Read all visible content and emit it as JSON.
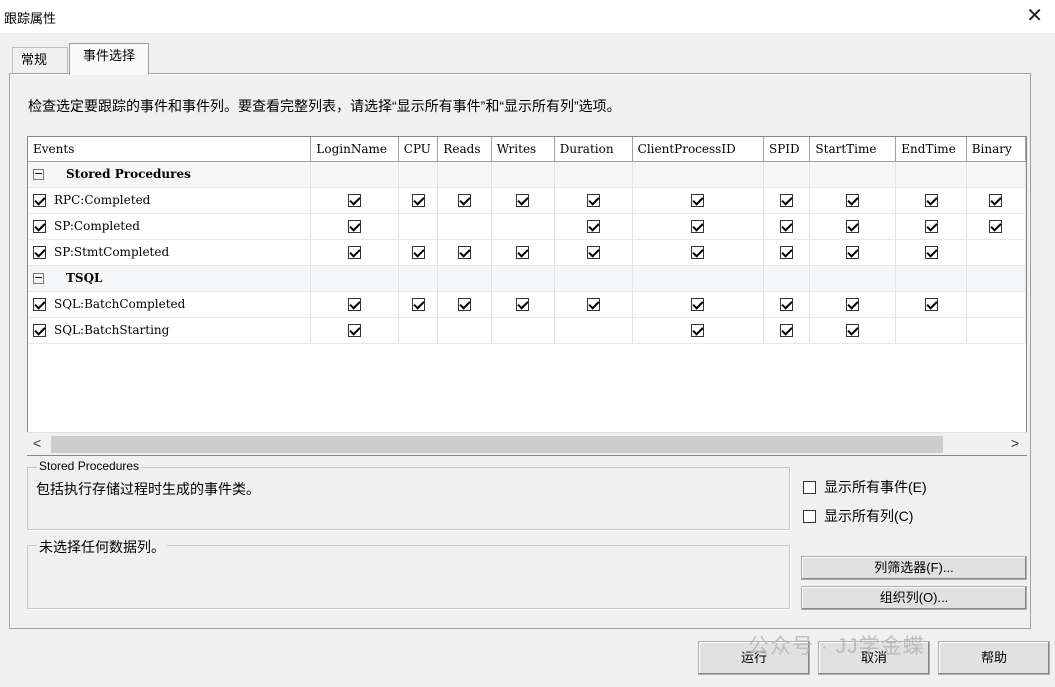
{
  "window": {
    "title": "跟踪属性",
    "close_symbol": "✕"
  },
  "tabs": [
    {
      "label": "常规",
      "active": false
    },
    {
      "label": "事件选择",
      "active": true
    }
  ],
  "instruction": "检查选定要跟踪的事件和事件列。要查看完整列表，请选择“显示所有事件”和“显示所有列”选项。",
  "grid": {
    "columns": [
      "Events",
      "LoginName",
      "CPU",
      "Reads",
      "Writes",
      "Duration",
      "ClientProcessID",
      "SPID",
      "StartTime",
      "EndTime",
      "Binary"
    ],
    "rows": [
      {
        "type": "group",
        "name": "Stored Procedures",
        "expander": "−"
      },
      {
        "type": "event",
        "name": "RPC:Completed",
        "checks": [
          true,
          true,
          true,
          true,
          true,
          true,
          true,
          true,
          true,
          true
        ]
      },
      {
        "type": "event",
        "name": "SP:Completed",
        "checks": [
          true,
          false,
          false,
          false,
          true,
          true,
          true,
          true,
          true,
          true
        ]
      },
      {
        "type": "event",
        "name": "SP:StmtCompleted",
        "checks": [
          true,
          true,
          true,
          true,
          true,
          true,
          true,
          true,
          true,
          false
        ]
      },
      {
        "type": "group",
        "name": "TSQL",
        "expander": "−"
      },
      {
        "type": "event",
        "name": "SQL:BatchCompleted",
        "checks": [
          true,
          true,
          true,
          true,
          true,
          true,
          true,
          true,
          true,
          false
        ]
      },
      {
        "type": "event",
        "name": "SQL:BatchStarting",
        "checks": [
          true,
          false,
          false,
          false,
          false,
          true,
          true,
          true,
          false,
          false
        ]
      }
    ],
    "scroll_left": "<",
    "scroll_right": ">"
  },
  "description": {
    "legend": "Stored Procedures",
    "text": "包括执行存储过程时生成的事件类。"
  },
  "columns_box": {
    "legend": "未选择任何数据列。"
  },
  "options": {
    "show_all_events": "显示所有事件(E)",
    "show_all_columns": "显示所有列(C)"
  },
  "buttons": {
    "filter": "列筛选器(F)...",
    "organize": "组织列(O)...",
    "run": "运行",
    "cancel": "取消",
    "help": "帮助"
  },
  "watermark": "公众号 · JJ学金蝶"
}
